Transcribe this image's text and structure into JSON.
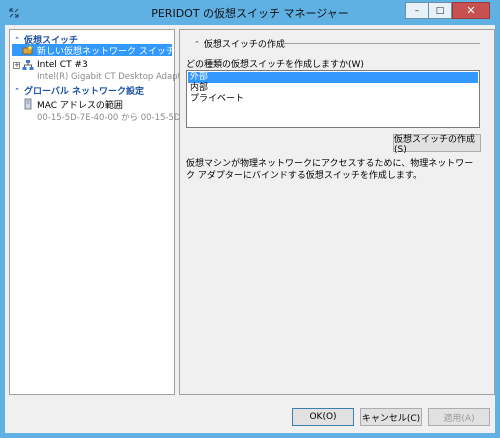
{
  "window": {
    "title": "PERIDOT の仮想スイッチ マネージャー",
    "minimize_label": "–",
    "maximize_label": "□",
    "close_label": "✕"
  },
  "sidebar": {
    "sections": [
      {
        "header": "仮想スイッチ",
        "items": [
          {
            "label": "新しい仮想ネットワーク スイッチ",
            "selected": true,
            "icon": "new-switch-icon"
          },
          {
            "label": "Intel CT #3",
            "sub": "Intel(R) Gigabit CT Desktop Adapt...",
            "icon": "network-switch-icon",
            "expander": "+"
          }
        ]
      },
      {
        "header": "グローバル ネットワーク設定",
        "items": [
          {
            "label": "MAC アドレスの範囲",
            "sub": "00-15-5D-7E-40-00 から 00-15-5D-...",
            "icon": "mac-address-icon"
          }
        ]
      }
    ]
  },
  "main": {
    "section_title": "仮想スイッチの作成",
    "prompt": "どの種類の仮想スイッチを作成しますか(W)",
    "switch_types": [
      "外部",
      "内部",
      "プライベート"
    ],
    "selected_type": "外部",
    "create_button": "仮想スイッチの作成(S)",
    "description": "仮想マシンが物理ネットワークにアクセスするために、物理ネットワーク アダプターにバインドする仮想スイッチを作成します。"
  },
  "footer": {
    "ok": "OK(O)",
    "cancel": "キャンセル(C)",
    "apply": "適用(A)"
  }
}
